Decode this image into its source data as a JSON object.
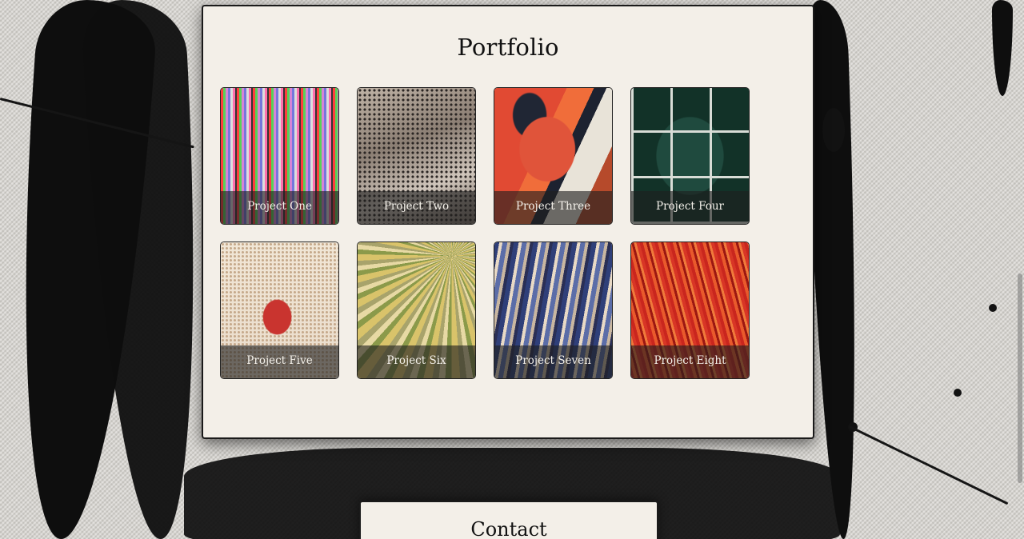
{
  "portfolio": {
    "title": "Portfolio",
    "projects": [
      {
        "label": "Project One"
      },
      {
        "label": "Project Two"
      },
      {
        "label": "Project Three"
      },
      {
        "label": "Project Four"
      },
      {
        "label": "Project Five"
      },
      {
        "label": "Project Six"
      },
      {
        "label": "Project Seven"
      },
      {
        "label": "Project Eight"
      }
    ]
  },
  "contact": {
    "title": "Contact"
  }
}
